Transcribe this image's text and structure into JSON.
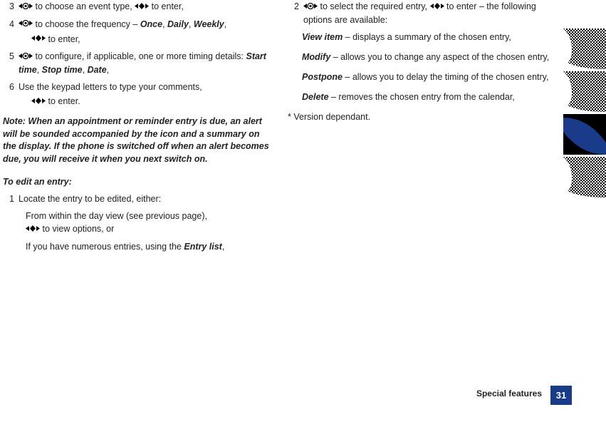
{
  "left": {
    "steps": [
      {
        "num": "3",
        "pre": "",
        "post": "to choose an event type, ",
        "post2": " to enter,"
      },
      {
        "num": "4",
        "pre": "",
        "post": "to choose the frequency – ",
        "terms": [
          "Once",
          "Daily",
          "Weekly"
        ],
        "tail": ",",
        "subIcon": true,
        "subText": " to enter,"
      },
      {
        "num": "5",
        "pre": "",
        "post": " to configure, if applicable, one or more timing details: ",
        "terms2": [
          "Start time",
          "Stop time",
          "Date"
        ],
        "tail2": ","
      },
      {
        "num": "6",
        "plain": "Use the keypad letters to type your comments, ",
        "subIcon": true,
        "subText2": " to enter."
      }
    ],
    "note": "Note: When an appointment or reminder entry is due, an alert will be sounded accompanied by the icon and a summary on the display. If the phone is switched off when an alert becomes due, you will receive it when you next switch on.",
    "editHeading": "To edit an entry:",
    "editStep1Num": "1",
    "editStep1": "Locate the entry to be edited, either:",
    "editSub1a": "From within the day view (see previous page), ",
    "editSub1aTail": " to view options, or",
    "editSub1bPre": "If you have numerous entries, using the ",
    "editSub1bTerm": "Entry list",
    "editSub1bTail": ","
  },
  "right": {
    "step2Num": "2",
    "step2a": " to select the required entry, ",
    "step2b": " to enter – the following options are available:",
    "options": [
      {
        "term": "View item",
        "desc": " – displays a summary of the chosen entry,"
      },
      {
        "term": "Modify",
        "desc": " – allows you to change any aspect of the chosen entry,"
      },
      {
        "term": "Postpone",
        "desc": " – allows you to delay the timing of the chosen entry,"
      },
      {
        "term": "Delete",
        "desc": " – removes the chosen entry from the calendar,"
      }
    ],
    "footnote": "* Version dependant."
  },
  "footer": "Special features",
  "pageNum": "31"
}
